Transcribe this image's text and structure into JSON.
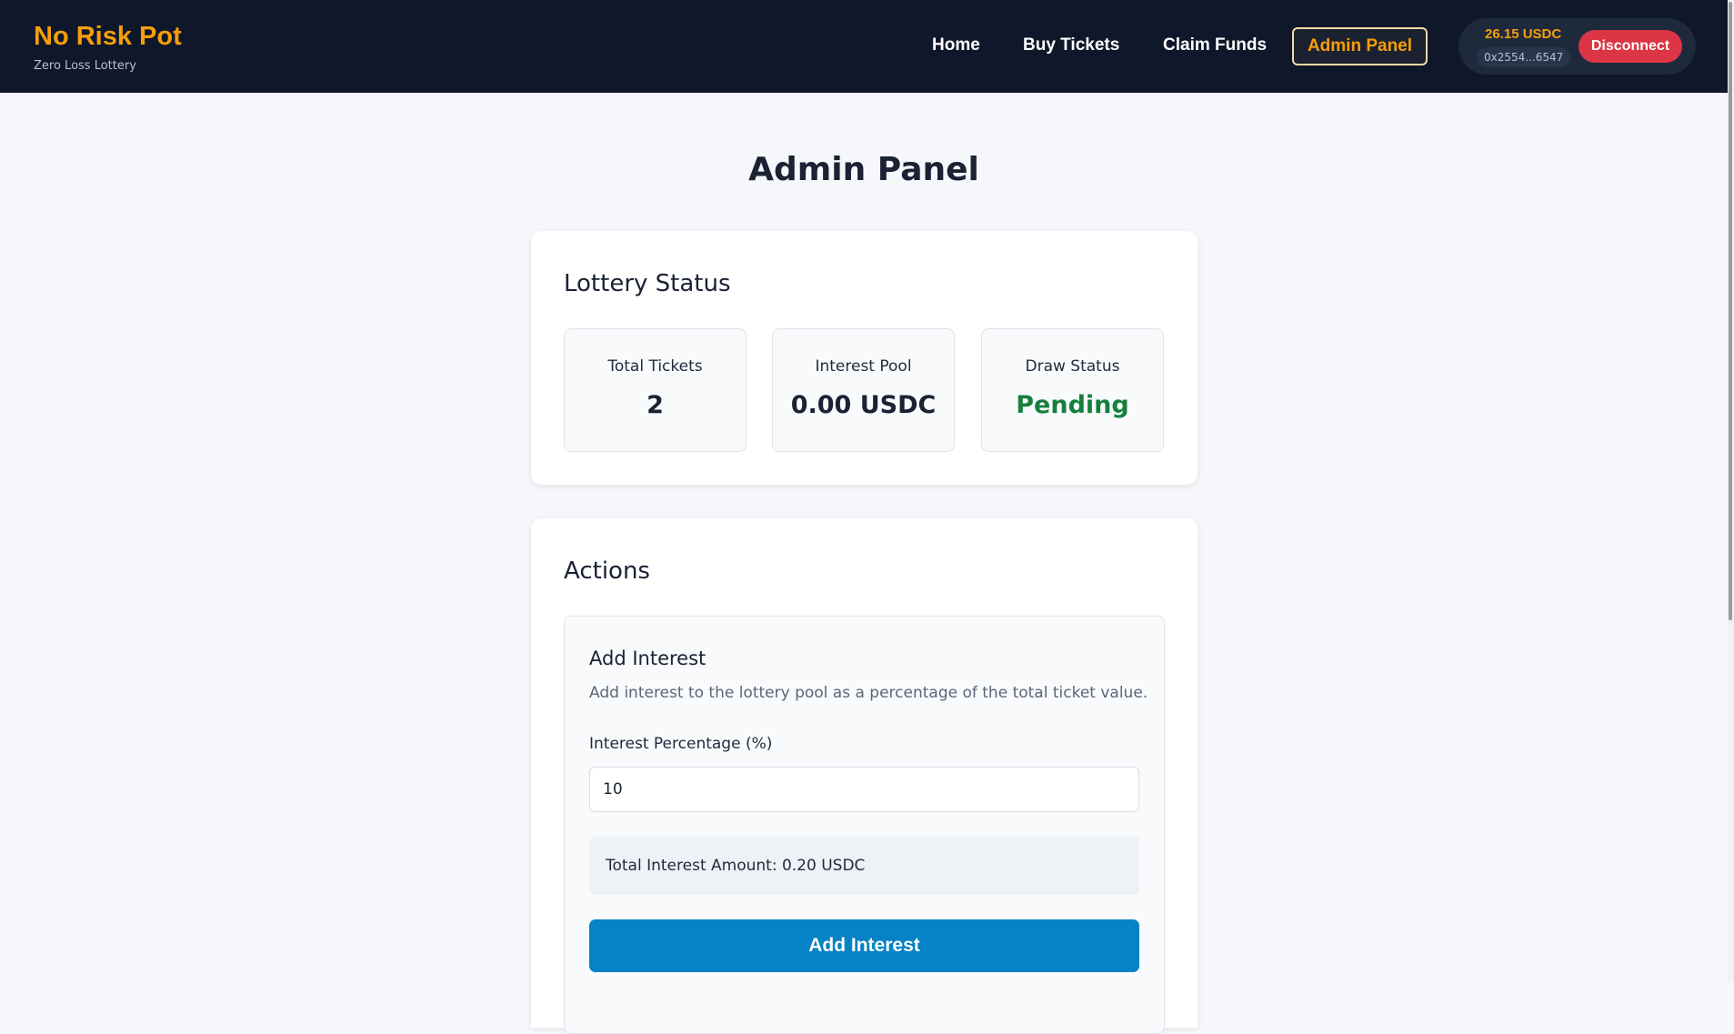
{
  "header": {
    "brand": "No Risk Pot",
    "tagline": "Zero Loss Lottery",
    "nav": {
      "home": "Home",
      "buy": "Buy Tickets",
      "claim": "Claim Funds",
      "admin": "Admin Panel"
    },
    "wallet": {
      "balance": "26.15 USDC",
      "address": "0x2554...6547",
      "disconnect": "Disconnect"
    }
  },
  "main": {
    "title": "Admin Panel",
    "status": {
      "title": "Lottery Status",
      "stats": [
        {
          "label": "Total Tickets",
          "value": "2"
        },
        {
          "label": "Interest Pool",
          "value": "0.00 USDC"
        },
        {
          "label": "Draw Status",
          "value": "Pending"
        }
      ]
    },
    "actions": {
      "title": "Actions",
      "add_interest": {
        "title": "Add Interest",
        "description": "Add interest to the lottery pool as a percentage of the total ticket value.",
        "field_label": "Interest Percentage (%)",
        "field_value": "10",
        "total_text": "Total Interest Amount: 0.20 USDC",
        "button": "Add Interest"
      }
    }
  },
  "colors": {
    "accent": "#f59e0b",
    "nav_bg": "#0f172a",
    "primary": "#0682c6",
    "danger": "#dc3545",
    "success": "#15803d"
  }
}
